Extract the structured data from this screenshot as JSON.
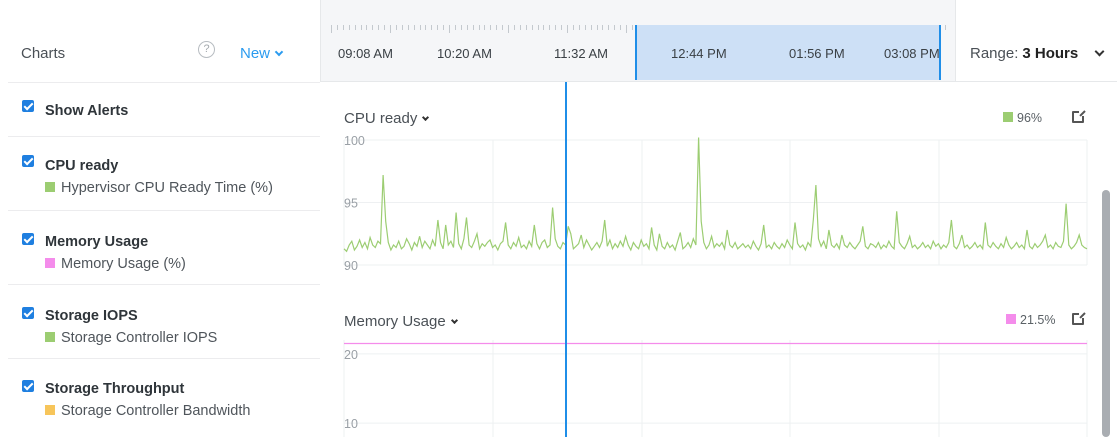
{
  "left_panel": {
    "title": "Charts",
    "help_icon": "?",
    "new_label": "New",
    "items": [
      {
        "label": "Show Alerts",
        "checked": true
      },
      {
        "label": "CPU ready",
        "sub": "Hypervisor CPU Ready Time (%)",
        "color": "#9ccd72",
        "checked": true
      },
      {
        "label": "Memory Usage",
        "sub": "Memory Usage (%)",
        "color": "#f48ceb",
        "checked": true
      },
      {
        "label": "Storage IOPS",
        "sub": "Storage Controller IOPS",
        "color": "#9ccd72",
        "checked": true
      },
      {
        "label": "Storage Throughput",
        "sub": "Storage Controller Bandwidth",
        "color": "#f7c55a",
        "checked": true
      }
    ]
  },
  "timeline": {
    "labels": [
      "09:08 AM",
      "10:20 AM",
      "11:32 AM",
      "12:44 PM",
      "01:56 PM",
      "03:08 PM"
    ],
    "selection_color": "#cde0f6"
  },
  "range": {
    "label": "Range:",
    "value": "3 Hours"
  },
  "colors": {
    "accent": "#1f8ee8",
    "cpu": "#9ccd72",
    "memory": "#f48ceb",
    "storage_bw": "#f7c55a"
  },
  "chart_data": [
    {
      "type": "line",
      "title": "CPU ready",
      "legend": "96%",
      "ylim": [
        90,
        100
      ],
      "yticks": [
        90,
        95,
        100
      ],
      "grid": true,
      "series": [
        {
          "values": [
            91.3,
            91.1,
            91.6,
            91.9,
            91.2,
            91.5,
            92.0,
            91.4,
            91.8,
            91.3,
            92.2,
            91.6,
            91.4,
            91.9,
            91.7,
            97.2,
            93.5,
            91.8,
            91.2,
            91.6,
            91.4,
            91.9,
            91.3,
            91.5,
            92.1,
            91.7,
            91.2,
            91.8,
            91.5,
            92.3,
            91.4,
            91.9,
            91.6,
            91.3,
            92.0,
            91.5,
            93.6,
            91.8,
            91.3,
            93.2,
            91.6,
            91.9,
            91.4,
            94.2,
            91.7,
            91.3,
            92.1,
            93.8,
            91.6,
            91.4,
            91.9,
            92.5,
            91.3,
            91.7,
            91.5,
            91.8,
            92.0,
            91.4,
            91.6,
            91.2,
            91.7,
            91.9,
            93.4,
            91.6,
            91.3,
            91.8,
            91.5,
            92.2,
            91.4,
            91.6,
            91.3,
            91.9,
            91.5,
            93.2,
            91.7,
            91.3,
            91.8,
            92.0,
            91.4,
            91.6,
            94.6,
            92.1,
            91.5,
            91.3,
            91.8,
            91.6,
            93.1,
            92.5,
            91.3,
            91.5,
            91.7,
            92.4,
            91.4,
            92.0,
            91.6,
            91.2,
            91.5,
            91.8,
            91.4,
            91.9,
            93.6,
            91.5,
            92.0,
            91.3,
            91.7,
            91.4,
            91.9,
            91.5,
            92.3,
            91.6,
            91.2,
            91.8,
            91.5,
            91.3,
            92.0,
            91.5,
            91.7,
            91.3,
            93.0,
            91.6,
            91.2,
            92.5,
            91.5,
            91.3,
            91.8,
            91.4,
            91.6,
            91.2,
            91.9,
            92.6,
            91.3,
            91.5,
            91.8,
            91.4,
            92.1,
            91.6,
            100.2,
            93.5,
            91.8,
            91.3,
            91.6,
            92.3,
            91.4,
            91.7,
            91.5,
            91.8,
            91.3,
            92.8,
            91.6,
            91.4,
            91.8,
            91.3,
            91.5,
            91.7,
            91.4,
            91.6,
            91.3,
            91.9,
            91.5,
            91.2,
            91.7,
            93.2,
            91.4,
            91.6,
            91.3,
            91.8,
            91.5,
            91.3,
            91.7,
            91.4,
            92.0,
            91.6,
            91.3,
            93.4,
            91.7,
            91.4,
            91.6,
            91.2,
            91.8,
            91.5,
            93.6,
            96.4,
            92.1,
            91.5,
            91.9,
            91.3,
            92.8,
            91.6,
            91.4,
            91.7,
            91.3,
            92.4,
            91.6,
            91.4,
            91.8,
            91.5,
            91.3,
            91.6,
            91.9,
            93.1,
            91.5,
            91.3,
            91.7,
            91.6,
            91.4,
            91.8,
            91.3,
            91.6,
            91.4,
            91.9,
            91.5,
            91.3,
            94.3,
            91.8,
            91.5,
            91.3,
            91.7,
            92.3,
            91.4,
            91.6,
            91.3,
            91.5,
            91.8,
            91.4,
            91.6,
            91.3,
            91.9,
            91.5,
            91.7,
            91.3,
            91.6,
            91.4,
            91.8,
            93.6,
            91.5,
            91.3,
            91.7,
            92.4,
            91.4,
            91.6,
            91.3,
            91.5,
            91.8,
            91.4,
            91.6,
            91.3,
            93.4,
            91.6,
            91.4,
            91.8,
            91.5,
            91.3,
            91.7,
            91.4,
            92.2,
            91.6,
            91.3,
            91.5,
            91.8,
            91.4,
            91.6,
            91.3,
            92.8,
            91.5,
            91.3,
            91.7,
            91.4,
            91.6,
            91.9,
            92.4,
            91.4,
            91.6,
            91.3,
            91.8,
            91.5,
            91.4,
            91.9,
            94.9,
            91.6,
            91.3,
            91.5,
            91.8,
            92.4,
            91.6,
            91.4,
            91.3
          ]
        }
      ]
    },
    {
      "type": "line",
      "title": "Memory Usage",
      "legend": "21.5%",
      "ylim": [
        8,
        22
      ],
      "yticks": [
        10,
        20
      ],
      "grid": true,
      "series": [
        {
          "values": [
            21.5,
            21.5
          ]
        }
      ]
    }
  ]
}
